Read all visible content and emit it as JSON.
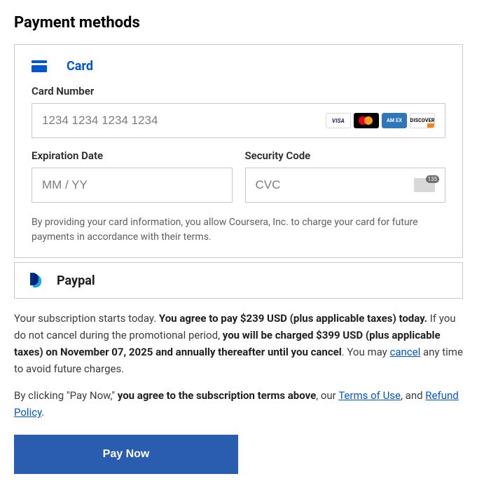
{
  "heading": "Payment methods",
  "card": {
    "title": "Card",
    "number_label": "Card Number",
    "number_placeholder": "1234 1234 1234 1234",
    "exp_label": "Expiration Date",
    "exp_placeholder": "MM / YY",
    "cvc_label": "Security Code",
    "cvc_placeholder": "CVC",
    "logos": {
      "visa": "VISA",
      "amex": "AM EX",
      "discover": "DISCOVER"
    },
    "consent": "By providing your card information, you allow Coursera, Inc. to charge your card for future payments in accordance with their terms."
  },
  "paypal": {
    "title": "Paypal"
  },
  "terms1": {
    "a": "Your subscription starts today. ",
    "b": "You agree to pay $239 USD (plus applicable taxes) today.",
    "c": " If you do not cancel during the promotional period, ",
    "d": "you will be charged $399 USD (plus applicable taxes) on November 07, 2025 and annually thereafter until you cancel",
    "e": ". You may ",
    "cancel_link": "cancel",
    "f": " any time to avoid future charges."
  },
  "terms2": {
    "a": "By clicking \"Pay Now,\" ",
    "b": "you agree to the subscription terms above",
    "c": ", our ",
    "tou": "Terms of Use",
    "d": ", and ",
    "refund": "Refund Policy",
    "e": "."
  },
  "pay_button": "Pay Now"
}
